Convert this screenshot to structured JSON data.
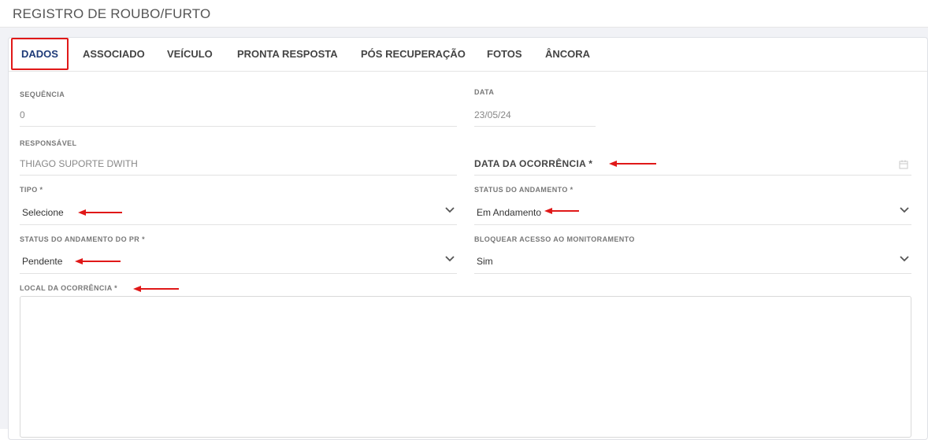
{
  "page": {
    "title": "REGISTRO DE ROUBO/FURTO"
  },
  "tabs": [
    {
      "label": "DADOS"
    },
    {
      "label": "ASSOCIADO"
    },
    {
      "label": "VEÍCULO"
    },
    {
      "label": "PRONTA RESPOSTA"
    },
    {
      "label": "PÓS RECUPERAÇÃO"
    },
    {
      "label": "FOTOS"
    },
    {
      "label": "ÂNCORA"
    }
  ],
  "form": {
    "sequencia": {
      "label": "SEQUÊNCIA",
      "value": "0"
    },
    "data": {
      "label": "DATA",
      "value": "23/05/24"
    },
    "responsavel": {
      "label": "RESPONSÁVEL",
      "value": "THIAGO SUPORTE DWITH"
    },
    "data_ocorrencia": {
      "label": "DATA DA OCORRÊNCIA *"
    },
    "tipo": {
      "label": "TIPO *",
      "value": "Selecione"
    },
    "status_andamento": {
      "label": "STATUS DO ANDAMENTO *",
      "value": "Em Andamento"
    },
    "status_andamento_pr": {
      "label": "STATUS DO ANDAMENTO DO PR *",
      "value": "Pendente"
    },
    "bloquear_acesso": {
      "label": "BLOQUEAR ACESSO AO MONITORAMENTO",
      "value": "Sim"
    },
    "local_ocorrencia": {
      "label": "LOCAL DA OCORRÊNCIA *",
      "value": ""
    }
  },
  "colors": {
    "accent": "#1e3a78",
    "highlight": "#e01818",
    "background": "#f1f2f6"
  },
  "icons": {
    "chevron": "chevron-down-icon",
    "calendar": "calendar-icon",
    "arrow": "red-arrow-annotation"
  }
}
